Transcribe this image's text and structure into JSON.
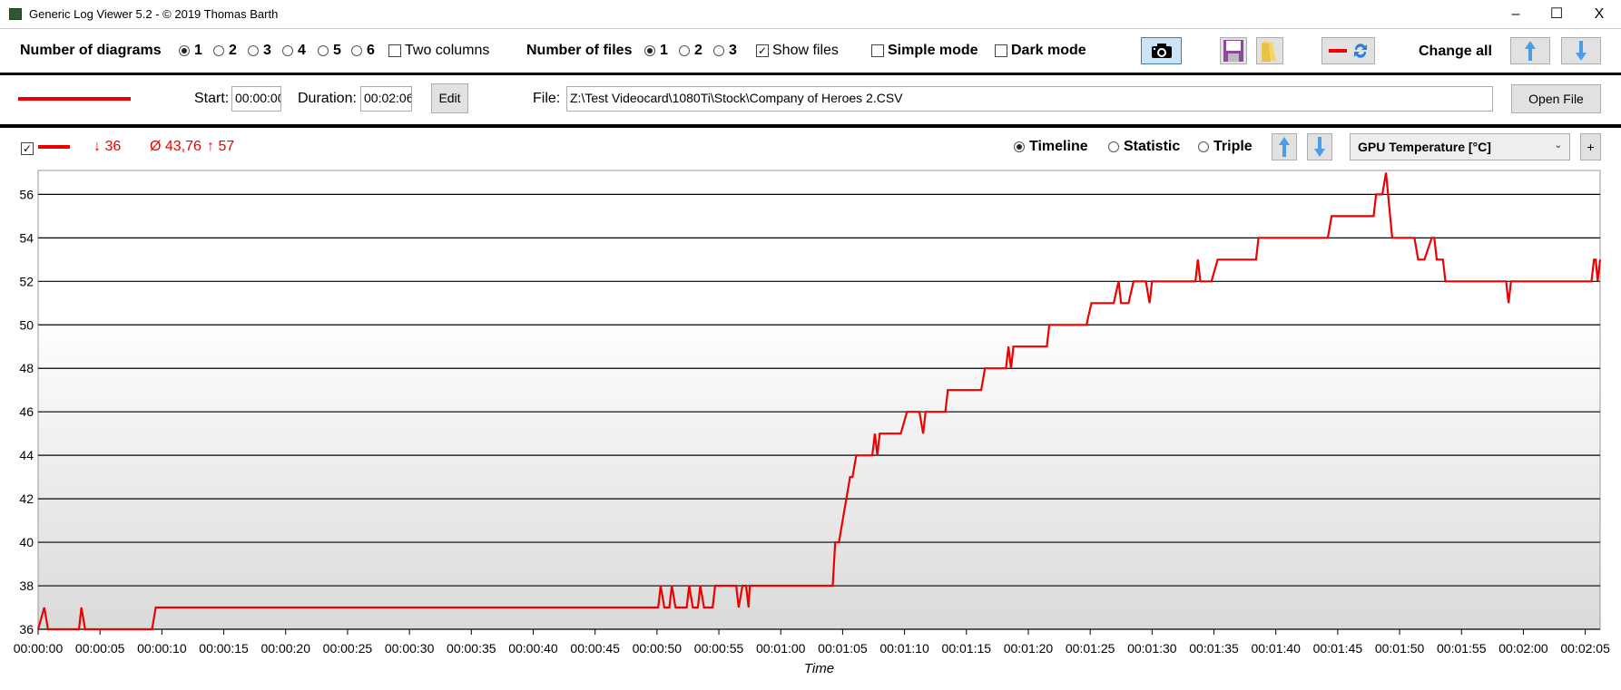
{
  "window": {
    "title": "Generic Log Viewer 5.2 - © 2019 Thomas Barth",
    "minimize": "–",
    "maximize": "☐",
    "close": "X"
  },
  "toolbar": {
    "diagrams_label": "Number of diagrams",
    "diagram_options": [
      "1",
      "2",
      "3",
      "4",
      "5",
      "6"
    ],
    "diagrams_selected": "1",
    "two_columns": "Two columns",
    "two_columns_checked": false,
    "files_label": "Number of files",
    "file_options": [
      "1",
      "2",
      "3"
    ],
    "files_selected": "1",
    "show_files": "Show files",
    "show_files_checked": true,
    "simple_mode": "Simple mode",
    "simple_mode_checked": false,
    "dark_mode": "Dark mode",
    "dark_mode_checked": false,
    "change_all": "Change all"
  },
  "file_row": {
    "line_color": "#ee0000",
    "start_label": "Start:",
    "start_value": "00:00:00",
    "duration_label": "Duration:",
    "duration_value": "00:02:06",
    "edit": "Edit",
    "file_label": "File:",
    "file_value": "Z:\\Test Videocard\\1080Ti\\Stock\\Company of Heroes 2.CSV",
    "open_file": "Open File"
  },
  "diagram": {
    "visible_checked": true,
    "min": "↓ 36",
    "avg": "Ø 43,76",
    "max": "↑ 57",
    "modes": [
      "Timeline",
      "Statistic",
      "Triple"
    ],
    "mode_selected": "Timeline",
    "sensor": "GPU Temperature [°C]",
    "add": "+"
  },
  "chart_data": {
    "type": "line",
    "xlabel": "Time",
    "ylabel": "",
    "ylim": [
      36,
      57.1
    ],
    "xlim": [
      0,
      126.2
    ],
    "grid": "horizontal",
    "color": "#ee0000",
    "yticks": [
      36,
      38,
      40,
      42,
      44,
      46,
      48,
      50,
      52,
      54,
      56
    ],
    "xticks": [
      0,
      5,
      10,
      15,
      20,
      25,
      30,
      35,
      40,
      45,
      50,
      55,
      60,
      65,
      70,
      75,
      80,
      85,
      90,
      95,
      100,
      105,
      110,
      115,
      120,
      125
    ],
    "xtick_labels": [
      "00:00:00",
      "00:00:05",
      "00:00:10",
      "00:00:15",
      "00:00:20",
      "00:00:25",
      "00:00:30",
      "00:00:35",
      "00:00:40",
      "00:00:45",
      "00:00:50",
      "00:00:55",
      "00:01:00",
      "00:01:05",
      "00:01:10",
      "00:01:15",
      "00:01:20",
      "00:01:25",
      "00:01:30",
      "00:01:35",
      "00:01:40",
      "00:01:45",
      "00:01:50",
      "00:01:55",
      "00:02:00",
      "00:02:05"
    ],
    "points": [
      [
        0,
        36
      ],
      [
        0.5,
        37
      ],
      [
        0.8,
        36
      ],
      [
        3.3,
        36
      ],
      [
        3.5,
        37
      ],
      [
        3.8,
        36
      ],
      [
        9.2,
        36
      ],
      [
        9.5,
        37
      ],
      [
        50.1,
        37
      ],
      [
        50.3,
        38
      ],
      [
        50.6,
        37
      ],
      [
        51,
        37
      ],
      [
        51.2,
        38
      ],
      [
        51.5,
        37
      ],
      [
        52.4,
        37
      ],
      [
        52.6,
        38
      ],
      [
        52.9,
        37
      ],
      [
        53.3,
        37
      ],
      [
        53.5,
        38
      ],
      [
        53.8,
        37
      ],
      [
        54.5,
        37
      ],
      [
        54.7,
        38
      ],
      [
        56.4,
        38
      ],
      [
        56.6,
        37
      ],
      [
        56.9,
        38
      ],
      [
        57.2,
        38
      ],
      [
        57.4,
        37
      ],
      [
        57.5,
        38
      ],
      [
        64.2,
        38
      ],
      [
        64.4,
        40
      ],
      [
        64.7,
        40
      ],
      [
        65,
        41
      ],
      [
        65.6,
        43
      ],
      [
        65.8,
        43
      ],
      [
        66.1,
        44
      ],
      [
        67.4,
        44
      ],
      [
        67.6,
        45
      ],
      [
        67.8,
        44
      ],
      [
        68,
        45
      ],
      [
        69.7,
        45
      ],
      [
        70.2,
        46
      ],
      [
        71.2,
        46
      ],
      [
        71.5,
        45
      ],
      [
        71.7,
        46
      ],
      [
        73.3,
        46
      ],
      [
        73.5,
        47
      ],
      [
        76.2,
        47
      ],
      [
        76.5,
        48
      ],
      [
        78.2,
        48
      ],
      [
        78.4,
        49
      ],
      [
        78.6,
        48
      ],
      [
        78.8,
        49
      ],
      [
        81.5,
        49
      ],
      [
        81.7,
        50
      ],
      [
        84.7,
        50
      ],
      [
        85.1,
        51
      ],
      [
        86.9,
        51
      ],
      [
        87.3,
        52
      ],
      [
        87.5,
        51
      ],
      [
        88.1,
        51
      ],
      [
        88.5,
        52
      ],
      [
        89.5,
        52
      ],
      [
        89.8,
        51
      ],
      [
        90,
        52
      ],
      [
        93.5,
        52
      ],
      [
        93.7,
        53
      ],
      [
        93.9,
        52
      ],
      [
        94.8,
        52
      ],
      [
        95.3,
        53
      ],
      [
        98.4,
        53
      ],
      [
        98.6,
        54
      ],
      [
        104.2,
        54
      ],
      [
        104.5,
        55
      ],
      [
        107.9,
        55
      ],
      [
        108.1,
        56
      ],
      [
        108.6,
        56
      ],
      [
        108.9,
        57
      ],
      [
        109.4,
        54
      ],
      [
        111.2,
        54
      ],
      [
        111.5,
        53
      ],
      [
        112,
        53
      ],
      [
        112.6,
        54
      ],
      [
        112.8,
        54
      ],
      [
        113,
        53
      ],
      [
        113.5,
        53
      ],
      [
        113.7,
        52
      ],
      [
        118.6,
        52
      ],
      [
        118.8,
        51
      ],
      [
        119,
        52
      ],
      [
        125.5,
        52
      ],
      [
        125.7,
        53
      ],
      [
        125.85,
        53
      ],
      [
        126,
        52
      ],
      [
        126.2,
        53
      ]
    ]
  }
}
